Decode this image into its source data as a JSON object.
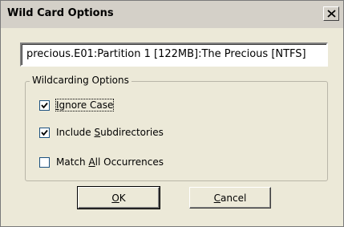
{
  "window": {
    "title": "Wild Card Options"
  },
  "path_field": {
    "value": "precious.E01:Partition 1 [122MB]:The Precious [NTFS]"
  },
  "group": {
    "legend": "Wildcarding Options"
  },
  "options": [
    {
      "pre": "",
      "accel": "I",
      "post": "gnore Case",
      "checked": true
    },
    {
      "pre": "Include ",
      "accel": "S",
      "post": "ubdirectories",
      "checked": true
    },
    {
      "pre": "Match ",
      "accel": "A",
      "post": "ll Occurrences",
      "checked": false
    }
  ],
  "buttons": {
    "ok": {
      "accel": "O",
      "post": "K"
    },
    "cancel": {
      "accel": "C",
      "post": "ancel"
    }
  },
  "icons": {
    "close": "close-icon",
    "check": "check-icon"
  }
}
